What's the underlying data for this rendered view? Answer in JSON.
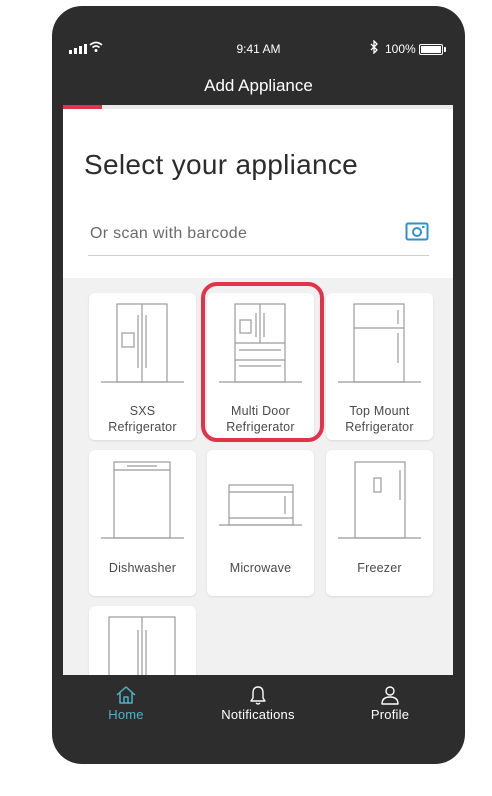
{
  "status_bar": {
    "time": "9:41 AM",
    "battery": "100%"
  },
  "header": {
    "title": "Add Appliance"
  },
  "progress": {
    "fraction": 0.1
  },
  "main": {
    "heading": "Select your appliance",
    "scan_placeholder": "Or scan with barcode",
    "appliances": [
      {
        "line1": "SXS",
        "line2": "Refrigerator",
        "icon": "sxs-refrigerator-icon",
        "selected": false
      },
      {
        "line1": "Multi Door",
        "line2": "Refrigerator",
        "icon": "multi-door-refrigerator-icon",
        "selected": true
      },
      {
        "line1": "Top Mount",
        "line2": "Refrigerator",
        "icon": "top-mount-refrigerator-icon",
        "selected": false
      },
      {
        "line1": "Dishwasher",
        "line2": "",
        "icon": "dishwasher-icon",
        "selected": false
      },
      {
        "line1": "Microwave",
        "line2": "",
        "icon": "microwave-icon",
        "selected": false
      },
      {
        "line1": "Freezer",
        "line2": "",
        "icon": "freezer-icon",
        "selected": false
      }
    ]
  },
  "tabs": [
    {
      "label": "Home",
      "icon": "home-icon",
      "active": true
    },
    {
      "label": "Notifications",
      "icon": "bell-icon",
      "active": false
    },
    {
      "label": "Profile",
      "icon": "user-icon",
      "active": false
    }
  ],
  "colors": {
    "accent": "#e2334b",
    "active_tab": "#4fb2c8",
    "phone_frame": "#2d2d2d"
  }
}
